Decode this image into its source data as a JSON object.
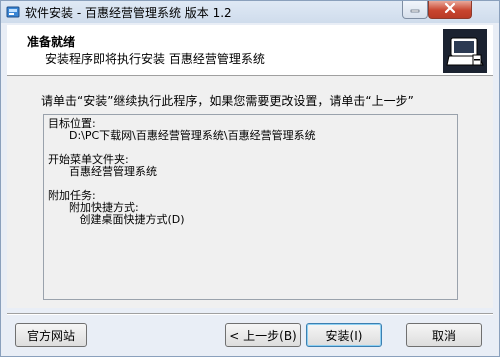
{
  "window": {
    "title": "软件安装 - 百惠经营管理系统 版本 1.2"
  },
  "header": {
    "title": "准备就绪",
    "subtitle": "安装程序即将执行安装 百惠经营管理系统"
  },
  "instruction": "请单击“安装”继续执行此程序，如果您需要更改设置，请单击“上一步”",
  "memo": {
    "dest_label": "目标位置:",
    "dest_value": "D:\\PC下载网\\百惠经营管理系统\\百惠经营管理系统",
    "start_label": "开始菜单文件夹:",
    "start_value": "百惠经营管理系统",
    "tasks_label": "附加任务:",
    "tasks_group": "附加快捷方式:",
    "tasks_item": "创建桌面快捷方式(D)"
  },
  "buttons": {
    "site": "官方网站",
    "back": "< 上一步(B)",
    "install": "安装(I)",
    "cancel": "取消"
  }
}
